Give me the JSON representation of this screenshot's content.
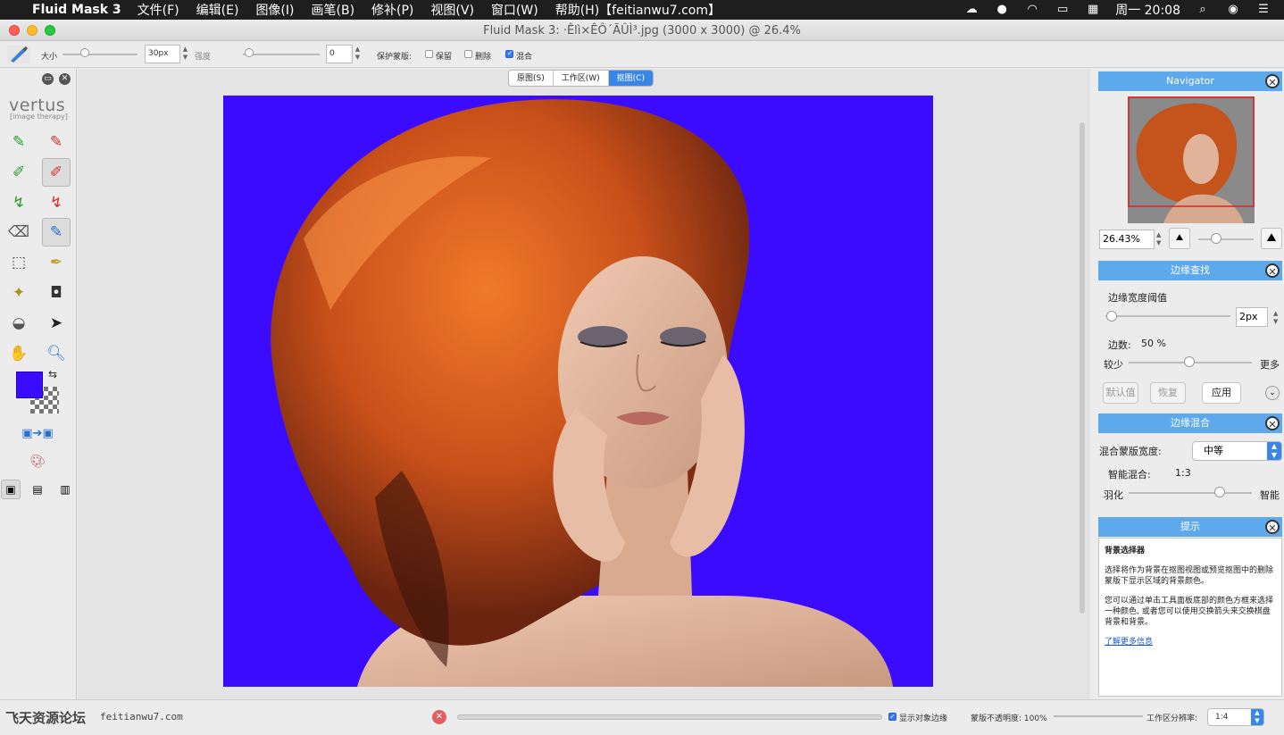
{
  "menubar": {
    "app_name": "Fluid Mask 3",
    "items": [
      "文件(F)",
      "编辑(E)",
      "图像(I)",
      "画笔(B)",
      "修补(P)",
      "视图(V)",
      "窗口(W)",
      "帮助(H)【feitianwu7.com】"
    ],
    "clock": "周一 20:08"
  },
  "window": {
    "title": "Fluid Mask 3: ·Êlì×ÊÔ´ÃÛÌ³.jpg (3000 x 3000) @ 26.4%"
  },
  "options": {
    "size_label": "大小",
    "size_value": "30px",
    "strength_label": "强度",
    "strength_value": "0",
    "protect_label": "保护蒙版:",
    "keep_label": "保留",
    "delete_label": "删除",
    "blend_label": "混合",
    "keep_checked": false,
    "delete_checked": false,
    "blend_checked": true
  },
  "toolpanel": {
    "logo": "vertus",
    "logo_sub": "[image therapy]",
    "foreground_color": "#3a0bff"
  },
  "view_tabs": [
    {
      "label": "原图(S)",
      "active": false
    },
    {
      "label": "工作区(W)",
      "active": false
    },
    {
      "label": "抠图(C)",
      "active": true
    }
  ],
  "navigator": {
    "title": "Navigator",
    "zoom_value": "26.43%"
  },
  "edge_find": {
    "title": "边缘查找",
    "threshold_label": "边缘宽度阈值",
    "threshold_value": "2px",
    "edges_label": "边数:",
    "edges_value": "50 %",
    "less_label": "较少",
    "more_label": "更多",
    "default_btn": "默认值",
    "restore_btn": "恢复",
    "apply_btn": "应用"
  },
  "edge_blend": {
    "title": "边缘混合",
    "width_label": "混合蒙版宽度:",
    "width_value": "中等",
    "smart_label": "智能混合:",
    "smart_value": "1:3",
    "feather_label": "羽化",
    "smart_right": "智能"
  },
  "hints": {
    "title": "提示",
    "heading": "背景选择器",
    "para1": "选择将作为背景在抠图视图或预览抠图中的删除蒙版下显示区域的背景颜色。",
    "para2": "您可以通过单击工具面板底部的颜色方框来选择一种颜色, 或者您可以使用交换箭头来交换棋盘背景和背景。",
    "link": "了解更多信息"
  },
  "statusbar": {
    "watermark_cn": "飞天资源论坛",
    "watermark_url": "feitianwu7.com",
    "show_edges_label": "显示对象边缘",
    "show_edges_checked": true,
    "opacity_label": "蒙版不透明度: 100%",
    "resolution_label": "工作区分辨率:",
    "resolution_value": "1:4"
  }
}
